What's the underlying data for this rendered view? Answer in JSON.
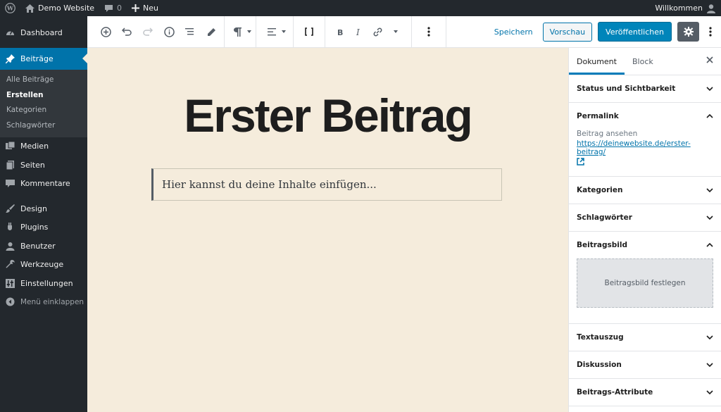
{
  "adminbar": {
    "site_name": "Demo Website",
    "comments_count": "0",
    "new_label": "Neu",
    "greeting": "Willkommen"
  },
  "sidebar": {
    "dashboard": "Dashboard",
    "posts": "Beiträge",
    "posts_sub": [
      "Alle Beiträge",
      "Erstellen",
      "Kategorien",
      "Schlagwörter"
    ],
    "media": "Medien",
    "pages": "Seiten",
    "comments": "Kommentare",
    "design": "Design",
    "plugins": "Plugins",
    "users": "Benutzer",
    "tools": "Werkzeuge",
    "settings": "Einstellungen",
    "collapse": "Menü einklappen"
  },
  "toolbar": {
    "save_draft": "Speichern",
    "preview": "Vorschau",
    "publish": "Veröffentlichen"
  },
  "editor": {
    "title": "Erster Beitrag",
    "paragraph": "Hier kannst du deine Inhalte einfügen..."
  },
  "settings_panel": {
    "tab_document": "Dokument",
    "tab_block": "Block",
    "status": "Status und Sichtbarkeit",
    "permalink": "Permalink",
    "view_post": "Beitrag ansehen",
    "permalink_url": "https://deinewebsite.de/erster-beitrag/",
    "categories": "Kategorien",
    "tags": "Schlagwörter",
    "featured_image": "Beitragsbild",
    "set_featured_image": "Beitragsbild festlegen",
    "excerpt": "Textauszug",
    "discussion": "Diskussion",
    "post_attributes": "Beitrags-Attribute"
  },
  "colors": {
    "admin_dark": "#23282d",
    "accent": "#0073aa",
    "canvas_bg": "#f5ecdc"
  }
}
